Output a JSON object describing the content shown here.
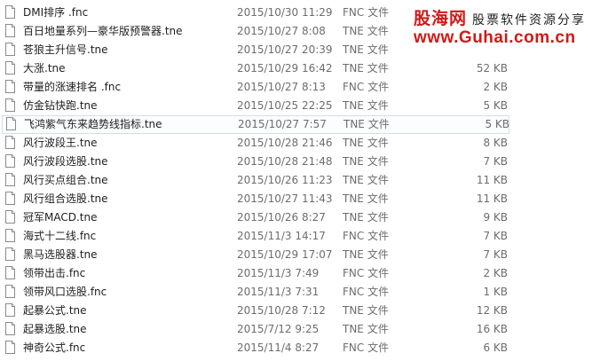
{
  "colors": {
    "watermark_red": "#d01a17",
    "selection_border": "#cbe1f6",
    "secondary_text": "#6d6d6d"
  },
  "watermark": {
    "brand": "股海网",
    "slogan": "股票软件资源分享",
    "url": "www.Guhai.com.cn"
  },
  "files": [
    {
      "name": "DMI排序 .fnc",
      "date": "2015/10/30 11:29",
      "type": "FNC 文件",
      "size": "",
      "icon": "file-icon"
    },
    {
      "name": "百日地量系列—豪华版预警器.tne",
      "date": "2015/10/27 8:08",
      "type": "TNE 文件",
      "size": "",
      "icon": "file-icon"
    },
    {
      "name": "苍狼主升信号.tne",
      "date": "2015/10/27 20:39",
      "type": "TNE 文件",
      "size": "",
      "icon": "file-icon"
    },
    {
      "name": "大涨.tne",
      "date": "2015/10/29 16:42",
      "type": "TNE 文件",
      "size": "52 KB",
      "icon": "file-icon"
    },
    {
      "name": "带量的涨速排名 .fnc",
      "date": "2015/10/27 8:13",
      "type": "FNC 文件",
      "size": "2 KB",
      "icon": "file-icon"
    },
    {
      "name": "仿金钻快跑.tne",
      "date": "2015/10/25 22:25",
      "type": "TNE 文件",
      "size": "5 KB",
      "icon": "file-icon"
    },
    {
      "name": "飞鸿紫气东来趋势线指标.tne",
      "date": "2015/10/27 7:57",
      "type": "TNE 文件",
      "size": "5 KB",
      "icon": "file-icon",
      "selected": true
    },
    {
      "name": "风行波段王.tne",
      "date": "2015/10/28 21:46",
      "type": "TNE 文件",
      "size": "8 KB",
      "icon": "file-icon"
    },
    {
      "name": "风行波段选股.tne",
      "date": "2015/10/28 21:48",
      "type": "TNE 文件",
      "size": "7 KB",
      "icon": "file-icon"
    },
    {
      "name": "风行买点组合.tne",
      "date": "2015/10/26 11:23",
      "type": "TNE 文件",
      "size": "11 KB",
      "icon": "file-icon"
    },
    {
      "name": "风行组合选股.tne",
      "date": "2015/10/27 11:43",
      "type": "TNE 文件",
      "size": "11 KB",
      "icon": "file-icon"
    },
    {
      "name": "冠军MACD.tne",
      "date": "2015/10/26 8:27",
      "type": "TNE 文件",
      "size": "9 KB",
      "icon": "file-icon"
    },
    {
      "name": "海式十二线.fnc",
      "date": "2015/11/3 14:17",
      "type": "FNC 文件",
      "size": "7 KB",
      "icon": "file-icon"
    },
    {
      "name": "黑马选股器.tne",
      "date": "2015/10/29 17:07",
      "type": "TNE 文件",
      "size": "7 KB",
      "icon": "file-icon"
    },
    {
      "name": "领带出击.fnc",
      "date": "2015/11/3 7:49",
      "type": "FNC 文件",
      "size": "2 KB",
      "icon": "file-icon"
    },
    {
      "name": "领带风口选股.fnc",
      "date": "2015/11/3 7:31",
      "type": "FNC 文件",
      "size": "1 KB",
      "icon": "file-icon"
    },
    {
      "name": "起暴公式.tne",
      "date": "2015/10/28 7:12",
      "type": "TNE 文件",
      "size": "12 KB",
      "icon": "file-icon"
    },
    {
      "name": "起暴选股.tne",
      "date": "2015/7/12 9:25",
      "type": "TNE 文件",
      "size": "16 KB",
      "icon": "file-icon"
    },
    {
      "name": "神奇公式.fnc",
      "date": "2015/11/4 8:27",
      "type": "FNC 文件",
      "size": "6 KB",
      "icon": "file-icon"
    }
  ]
}
